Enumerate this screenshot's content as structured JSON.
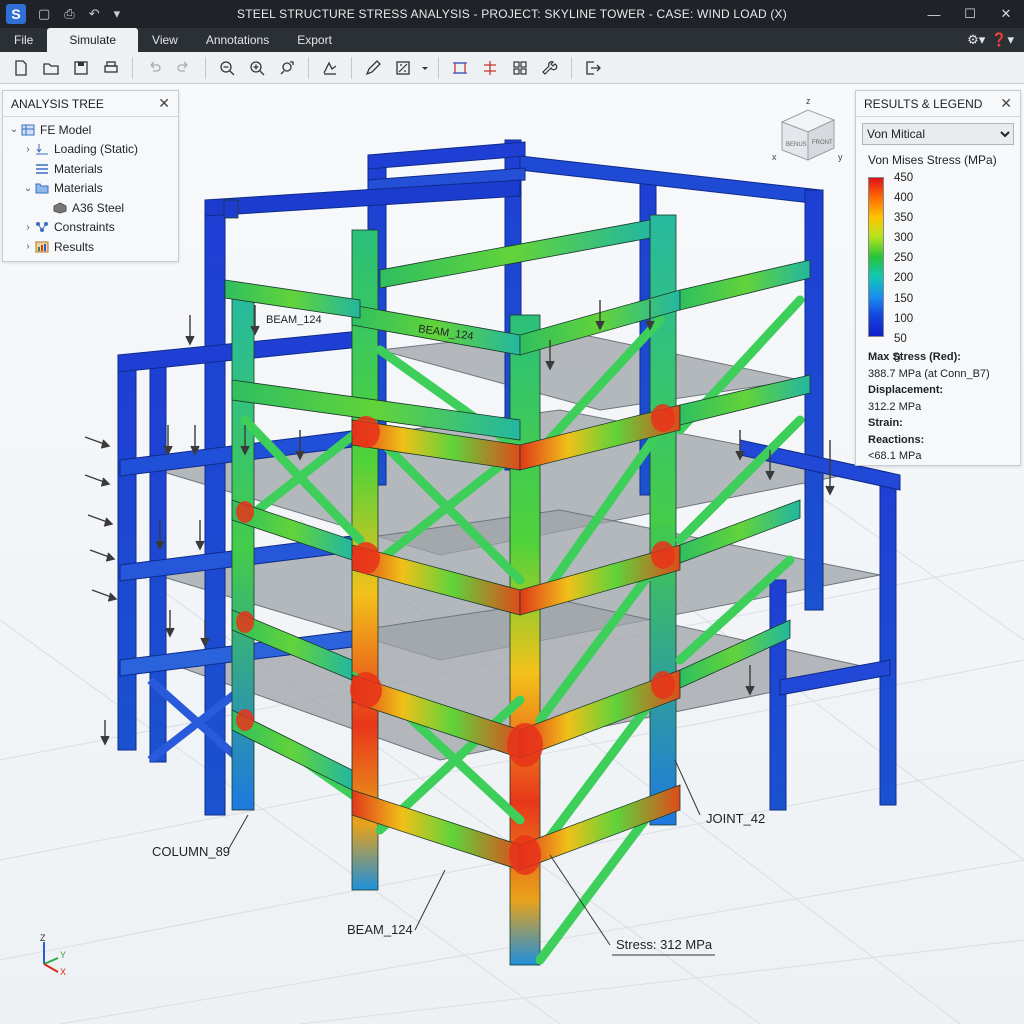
{
  "window": {
    "title": "STEEL STRUCTURE STRESS ANALYSIS - PROJECT: SKYLINE TOWER - CASE: WIND LOAD (X)",
    "logo": "S"
  },
  "menu": {
    "items": [
      "File",
      "Simulate",
      "View",
      "Annotations",
      "Export"
    ],
    "active": "Simulate"
  },
  "tree": {
    "title": "ANALYSIS TREE",
    "rows": [
      {
        "label": "FE Model",
        "icon": "model-icon"
      },
      {
        "label": "Loading (Static)",
        "icon": "load-icon"
      },
      {
        "label": "Materials",
        "icon": "list-icon"
      },
      {
        "label": "Materials",
        "icon": "folder-icon"
      },
      {
        "label": "A36 Steel",
        "icon": "material-icon"
      },
      {
        "label": "Constraints",
        "icon": "constraint-icon"
      },
      {
        "label": "Results",
        "icon": "results-icon"
      }
    ]
  },
  "legend": {
    "title": "RESULTS & LEGEND",
    "selected": "Von Mitical",
    "scale_title": "Von Mises Stress (MPa)",
    "ticks": [
      "450",
      "400",
      "350",
      "300",
      "250",
      "200",
      "150",
      "100",
      "50",
      "0"
    ],
    "max_stress_label": "Max Stress (Red):",
    "max_stress_value": "388.7 MPa (at Conn_B7)",
    "displacement_label": "Displacement:",
    "displacement_value": "312.2 MPa",
    "strain_label": "Strain:",
    "reactions_label": "Reactions:",
    "reactions_value": "<68.1 MPa"
  },
  "viewport": {
    "labels": {
      "beam_top": "BEAM_124",
      "beam_mid": "BEAM_124",
      "column": "COLUMN_89",
      "beam_bottom": "BEAM_124",
      "joint": "JOINT_42",
      "stress": "Stress: 312 MPa"
    },
    "viewcube": {
      "z": "z",
      "x": "x",
      "y": "y",
      "face1": "BENUS",
      "face2": "FRONT"
    },
    "triad": {
      "z": "Z",
      "y": "Y",
      "x": "X"
    }
  },
  "colors": {
    "low": "#1633c8",
    "mid": "#2fc24a",
    "high": "#e8221a"
  }
}
